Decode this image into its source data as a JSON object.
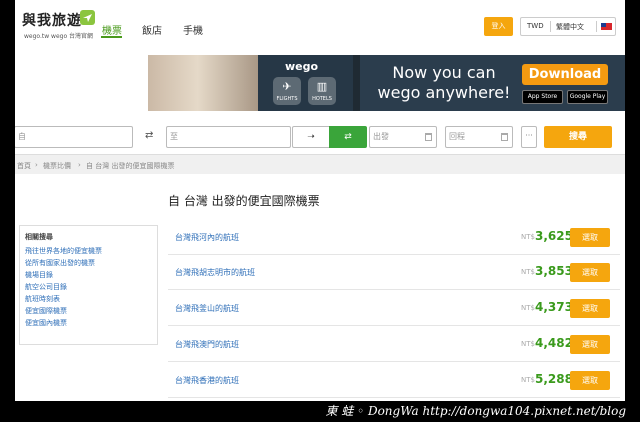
{
  "header": {
    "logo_title": "與我旅遊",
    "logo_sub": "wego.tw  wego 台灣官網",
    "nav": {
      "flights": "機票",
      "hotels": "飯店",
      "mobile": "手機"
    },
    "login": "登入",
    "currency": "TWD",
    "language": "繁體中文"
  },
  "banner": {
    "logo": "wego",
    "tile_flights": "FLIGHTS",
    "tile_hotels": "HOTELS",
    "headline": "Now you can wego anywhere!",
    "download": "Download",
    "app_store": "App Store",
    "google_play": "Google Play"
  },
  "search": {
    "origin_value": "自",
    "destination_value": "至",
    "oneway_symbol": "➝",
    "roundtrip_symbol": "⇄",
    "depart_placeholder": "出發",
    "return_placeholder": "回程",
    "more": "···",
    "button": "搜尋"
  },
  "breadcrumb": [
    "首頁",
    "機票比價",
    "自 台灣 出發的便宜國際機票"
  ],
  "heading": "自 台灣 出發的便宜國際機票",
  "sidebar": {
    "title": "相關搜尋",
    "links": [
      "飛往世界各地的便宜機票",
      "從所有國家出發的機票",
      "機場目錄",
      "航空公司目錄",
      "航班時刻表",
      "便宜國際機票",
      "便宜國內機票"
    ]
  },
  "results": [
    {
      "route": "台灣飛河內的航班",
      "currency": "NT$",
      "price": "3,625",
      "button": "選取"
    },
    {
      "route": "台灣飛胡志明市的航班",
      "currency": "NT$",
      "price": "3,853",
      "button": "選取"
    },
    {
      "route": "台灣飛釜山的航班",
      "currency": "NT$",
      "price": "4,373",
      "button": "選取"
    },
    {
      "route": "台灣飛澳門的航班",
      "currency": "NT$",
      "price": "4,482",
      "button": "選取"
    },
    {
      "route": "台灣飛香港的航班",
      "currency": "NT$",
      "price": "5,288",
      "button": "選取"
    }
  ],
  "watermark": "東 蛙 ◦ DongWa  http://dongwa104.pixnet.net/blog",
  "colors": {
    "accent": "#f5a60e",
    "green": "#3aa53a",
    "link": "#2f6fb8",
    "price": "#3a9a1c"
  }
}
